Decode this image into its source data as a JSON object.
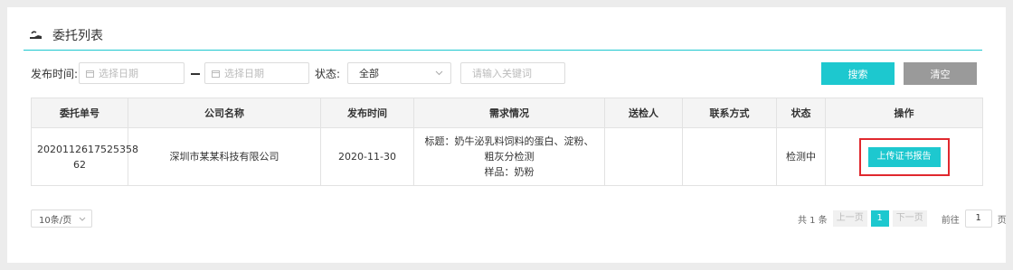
{
  "header": {
    "title": "委托列表"
  },
  "filters": {
    "publish_time_label": "发布时间:",
    "start_date_placeholder": "选择日期",
    "end_date_placeholder": "选择日期",
    "status_label": "状态:",
    "status_value": "全部",
    "keyword_placeholder": "请输入关键词",
    "search_label": "搜索",
    "clear_label": "清空"
  },
  "table": {
    "headers": [
      "委托单号",
      "公司名称",
      "发布时间",
      "需求情况",
      "送检人",
      "联系方式",
      "状态",
      "操作"
    ],
    "rows": [
      {
        "order_no": "2020112617525358 62",
        "company": "深圳市某某科技有限公司",
        "publish_time": "2020-11-30",
        "requirement_title": "标题：奶牛泌乳料饲料的蛋白、淀粉、粗灰分检测",
        "requirement_sample": "样品：奶粉",
        "inspector": "",
        "contact": "",
        "status": "检测中",
        "action_label": "上传证书报告"
      }
    ]
  },
  "pagination": {
    "page_size": "10条/页",
    "total": "共 1 条",
    "prev": "上一页",
    "current": "1",
    "next": "下一页",
    "goto_label": "前往",
    "goto_value": "1",
    "page_unit": "页"
  },
  "colors": {
    "accent": "#1dc8cf",
    "highlight": "#e0282e"
  }
}
